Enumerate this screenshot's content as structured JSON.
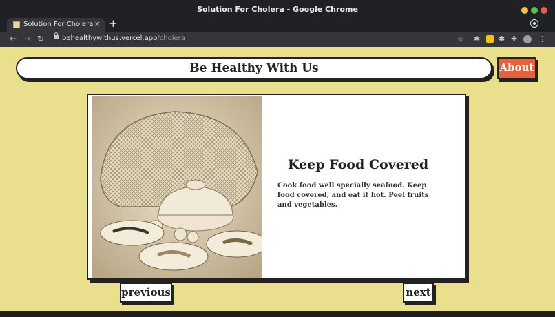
{
  "window": {
    "title": "Solution For Cholera - Google Chrome"
  },
  "tab": {
    "title": "Solution For Cholera",
    "close_glyph": "×",
    "new_tab_glyph": "+"
  },
  "toolbar": {
    "back_glyph": "←",
    "forward_glyph": "→",
    "reload_glyph": "↻",
    "url_host": "behealthywithus.vercel.app",
    "url_path": "/cholera",
    "star_glyph": "☆",
    "menu_glyph": "⋮",
    "ext_glyph": "✱",
    "puzzle_glyph": "✚"
  },
  "header": {
    "title": "Be Healthy With Us",
    "about_label": "About",
    "accent_color": "#e8603c",
    "page_bg": "#eadf8d"
  },
  "card": {
    "title": "Keep Food Covered",
    "body": "Cook food well specially seafood. Keep food covered, and eat it hot. Peel fruits and vegetables.",
    "image_alt": "sepia photo of a woven food cover over bowls and plates"
  },
  "nav": {
    "previous_label": "previous",
    "next_label": "next"
  }
}
